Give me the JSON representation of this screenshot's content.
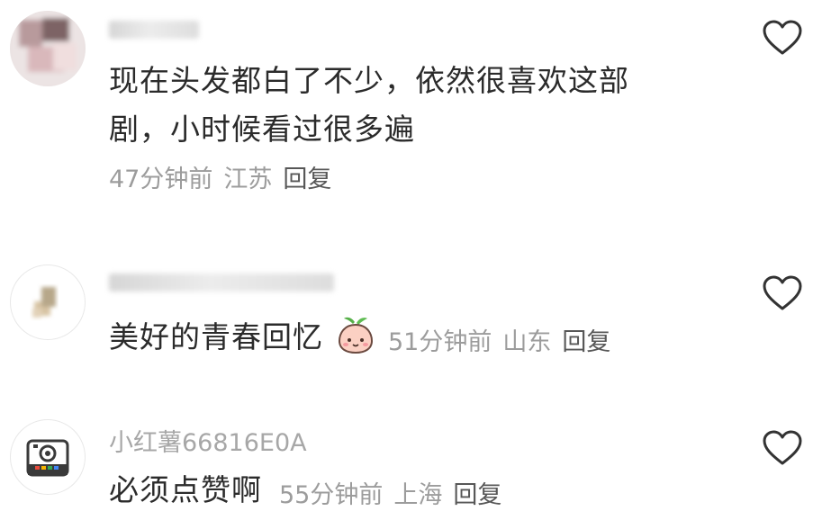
{
  "comments": [
    {
      "username": "",
      "text_lines": [
        "现在头发都白了不少，依然很喜欢这部",
        "剧，小时候看过很多遍"
      ],
      "time": "47分钟前",
      "location": "江苏",
      "reply_label": "回复"
    },
    {
      "username": "",
      "text": "美好的青春回忆",
      "emoji": "peach-emoji",
      "time": "51分钟前",
      "location": "山东",
      "reply_label": "回复"
    },
    {
      "username": "小红薯66816E0A",
      "text": "必须点赞啊",
      "time": "55分钟前",
      "location": "上海",
      "reply_label": "回复"
    }
  ],
  "icons": {
    "like": "heart-outline-icon",
    "avatar3": "camera-icon"
  },
  "colors": {
    "text": "#2b2b2b",
    "meta": "#9c9c9c",
    "reply": "#575757",
    "username": "#a7a7a7"
  }
}
